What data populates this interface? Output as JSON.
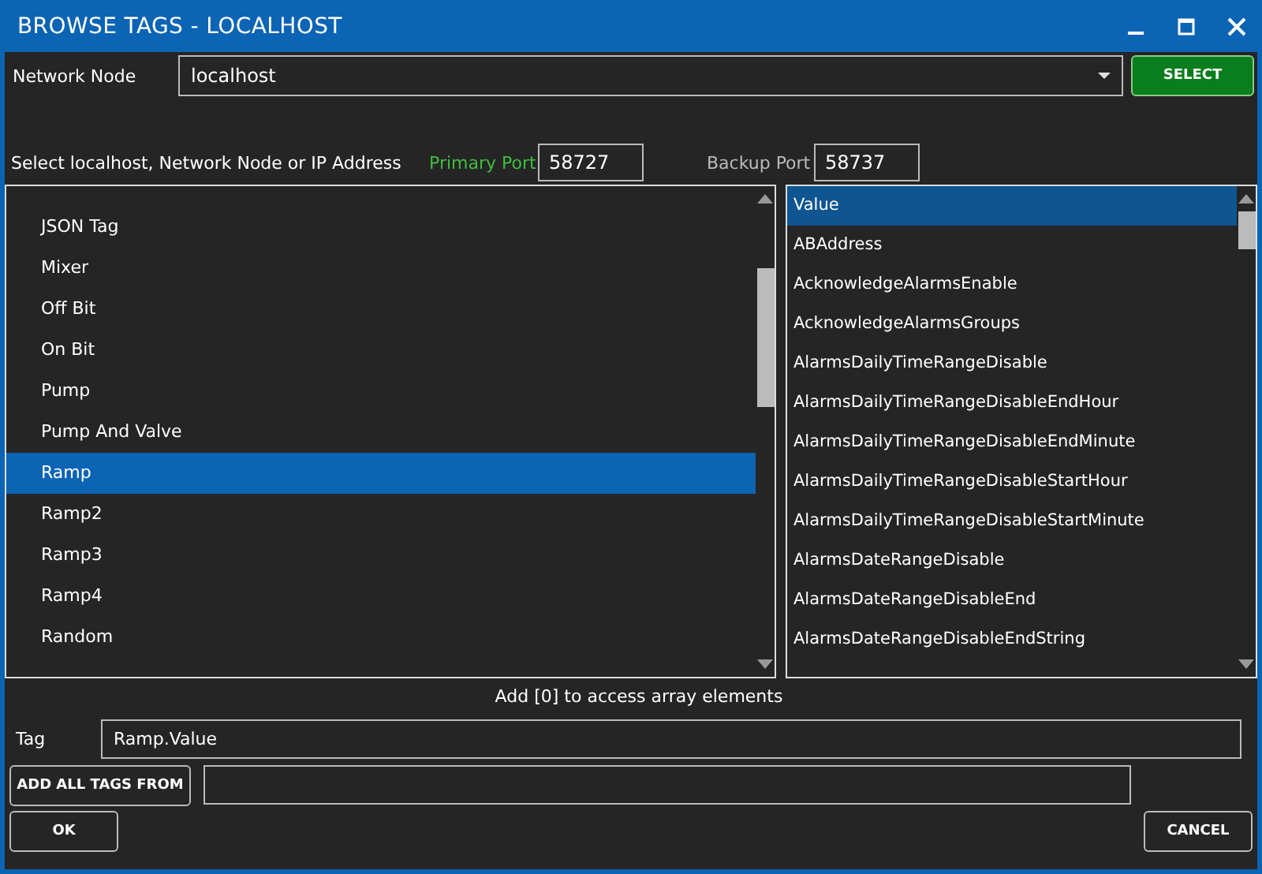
{
  "window": {
    "title": "BROWSE TAGS - LOCALHOST"
  },
  "network_node": {
    "label": "Network Node",
    "value": "localhost",
    "button": "SELECT"
  },
  "ports": {
    "hint": "Select localhost, Network Node or IP Address",
    "primary_label": "Primary Port",
    "primary_value": "58727",
    "backup_label": "Backup Port",
    "backup_value": "58737"
  },
  "objects": [
    {
      "label": "JSON Tag",
      "selected": false
    },
    {
      "label": "Mixer",
      "selected": false
    },
    {
      "label": "Off Bit",
      "selected": false
    },
    {
      "label": "On Bit",
      "selected": false
    },
    {
      "label": "Pump",
      "selected": false
    },
    {
      "label": "Pump And Valve",
      "selected": false
    },
    {
      "label": "Ramp",
      "selected": true
    },
    {
      "label": "Ramp2",
      "selected": false
    },
    {
      "label": "Ramp3",
      "selected": false
    },
    {
      "label": "Ramp4",
      "selected": false
    },
    {
      "label": "Random",
      "selected": false
    }
  ],
  "properties": [
    {
      "label": "Value",
      "selected": true
    },
    {
      "label": "ABAddress",
      "selected": false
    },
    {
      "label": "AcknowledgeAlarmsEnable",
      "selected": false
    },
    {
      "label": "AcknowledgeAlarmsGroups",
      "selected": false
    },
    {
      "label": "AlarmsDailyTimeRangeDisable",
      "selected": false
    },
    {
      "label": "AlarmsDailyTimeRangeDisableEndHour",
      "selected": false
    },
    {
      "label": "AlarmsDailyTimeRangeDisableEndMinute",
      "selected": false
    },
    {
      "label": "AlarmsDailyTimeRangeDisableStartHour",
      "selected": false
    },
    {
      "label": "AlarmsDailyTimeRangeDisableStartMinute",
      "selected": false
    },
    {
      "label": "AlarmsDateRangeDisable",
      "selected": false
    },
    {
      "label": "AlarmsDateRangeDisableEnd",
      "selected": false
    },
    {
      "label": "AlarmsDateRangeDisableEndString",
      "selected": false
    }
  ],
  "array_hint": "Add [0] to access array elements",
  "tag": {
    "label": "Tag",
    "value": "Ramp.Value"
  },
  "add_all": {
    "button": "ADD ALL TAGS FROM"
  },
  "buttons": {
    "ok": "OK",
    "cancel": "CANCEL"
  }
}
